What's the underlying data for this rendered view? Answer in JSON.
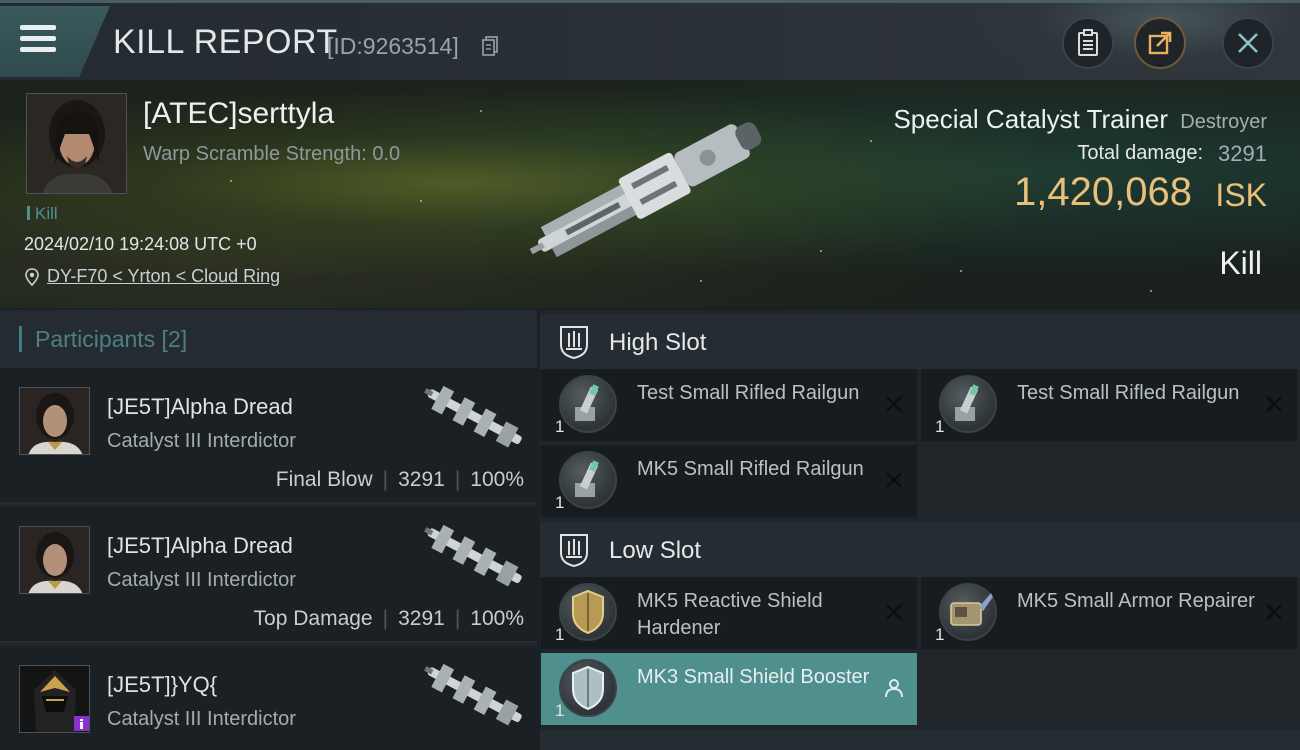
{
  "header": {
    "title": "KILL REPORT",
    "report_id": "[ID:9263514]",
    "buttons": [
      "clipboard-icon",
      "share-icon",
      "close-icon"
    ]
  },
  "victim": {
    "name": "[ATEC]serttyla",
    "warp_scramble": "Warp Scramble Strength: 0.0",
    "tag": "Kill",
    "datetime": "2024/02/10 19:24:08 UTC +0",
    "location": "DY-F70 < Yrton < Cloud Ring",
    "ship_name": "Special Catalyst Trainer",
    "ship_class": "Destroyer",
    "total_damage_label": "Total damage:",
    "total_damage": "3291",
    "isk_value": "1,420,068",
    "isk_unit": "ISK",
    "result": "Kill"
  },
  "participants": {
    "title": "Participants [2]",
    "items": [
      {
        "name": "[JE5T]Alpha Dread",
        "ship": "Catalyst III Interdictor",
        "role": "Final Blow",
        "damage": "3291",
        "percent": "100%"
      },
      {
        "name": "[JE5T]Alpha Dread",
        "ship": "Catalyst III Interdictor",
        "role": "Top Damage",
        "damage": "3291",
        "percent": "100%"
      },
      {
        "name": "[JE5T]}YQ{",
        "ship": "Catalyst III Interdictor",
        "role": "",
        "damage": "",
        "percent": ""
      }
    ]
  },
  "fittings": {
    "high_slot_title": "High Slot",
    "low_slot_title": "Low Slot",
    "high": [
      {
        "name": "Test Small Rifled Railgun",
        "qty": "1"
      },
      {
        "name": "Test Small Rifled Railgun",
        "qty": "1"
      },
      {
        "name": "MK5 Small Rifled Railgun",
        "qty": "1"
      }
    ],
    "low": [
      {
        "name": "MK5 Reactive Shield Hardener",
        "qty": "1"
      },
      {
        "name": "MK5 Small Armor Repairer",
        "qty": "1"
      },
      {
        "name": "MK3 Small Shield Booster",
        "qty": "1"
      }
    ]
  },
  "colors": {
    "accent": "#4f8f8e",
    "isk": "#e8c07a",
    "kill_tag": "#4e8f93"
  }
}
